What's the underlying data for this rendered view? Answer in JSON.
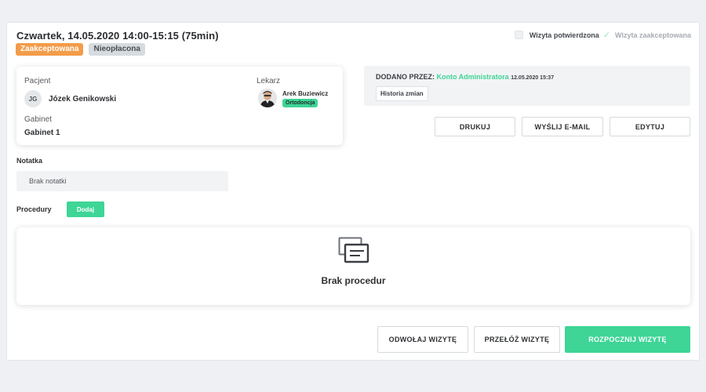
{
  "visit": {
    "title": "Czwartek, 14.05.2020 14:00-15:15 (75min)",
    "badges": {
      "status": "Zaakceptowana",
      "payment": "Nieopłacona"
    },
    "checks": {
      "confirmed_label": "Wizyta potwierdzona",
      "accepted_label": "Wizyta zaakceptowana",
      "confirmed": false,
      "accepted": true
    }
  },
  "patient_card": {
    "patient_label": "Pacjent",
    "patient_initials": "JG",
    "patient_name": "Józek Genikowski",
    "room_label": "Gabinet",
    "room_value": "Gabinet 1",
    "doctor_label": "Lekarz",
    "doctor_name": "Arek Buziewicz",
    "doctor_specialty": "Ortodoncja"
  },
  "added": {
    "prefix": "DODANO PRZEZ:",
    "by": "Konto Administratora",
    "date": "12.05.2020 15:37",
    "history_button": "Historia zmian"
  },
  "actions": {
    "print": "DRUKUJ",
    "email": "WYŚLIJ E-MAIL",
    "edit": "EDYTUJ"
  },
  "note": {
    "title": "Notatka",
    "value": "Brak notatki"
  },
  "procedures": {
    "title": "Procedury",
    "add_button": "Dodaj",
    "empty_text": "Brak procedur",
    "icon": "empty-list-icon"
  },
  "footer": {
    "cancel": "ODWOŁAJ WIZYTĘ",
    "reschedule": "PRZEŁÓŻ WIZYTĘ",
    "start": "ROZPOCZNIJ WIZYTĘ"
  },
  "colors": {
    "accent_green": "#3ed597",
    "accepted_orange": "#f39c4a",
    "unpaid_grey": "#d6dbe0"
  }
}
